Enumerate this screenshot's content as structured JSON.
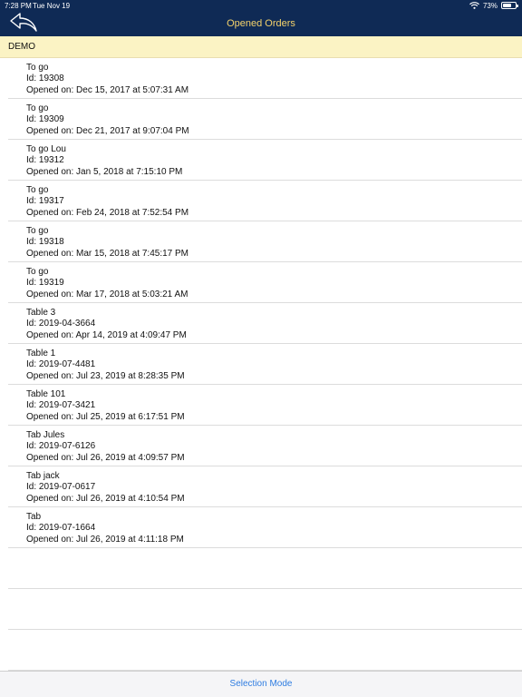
{
  "status_bar": {
    "time": "7:28 PM",
    "date": "Tue Nov 19",
    "battery_text": "73%",
    "battery_level": 0.73
  },
  "header": {
    "title": "Opened Orders",
    "back_icon": "curved-back-arrow-icon"
  },
  "section": {
    "label": "DEMO"
  },
  "orders": [
    {
      "name": "To go",
      "id": "Id: 19308",
      "opened": "Opened on: Dec 15, 2017 at 5:07:31 AM"
    },
    {
      "name": "To go",
      "id": "Id: 19309",
      "opened": "Opened on: Dec 21, 2017 at 9:07:04 PM"
    },
    {
      "name": "To go Lou",
      "id": "Id: 19312",
      "opened": "Opened on: Jan 5, 2018 at 7:15:10 PM"
    },
    {
      "name": "To go",
      "id": "Id: 19317",
      "opened": "Opened on: Feb 24, 2018 at 7:52:54 PM"
    },
    {
      "name": "To go",
      "id": "Id: 19318",
      "opened": "Opened on: Mar 15, 2018 at 7:45:17 PM"
    },
    {
      "name": "To go",
      "id": "Id: 19319",
      "opened": "Opened on: Mar 17, 2018 at 5:03:21 AM"
    },
    {
      "name": "Table 3",
      "id": "Id: 2019-04-3664",
      "opened": "Opened on: Apr 14, 2019 at 4:09:47 PM"
    },
    {
      "name": "Table 1",
      "id": "Id: 2019-07-4481",
      "opened": "Opened on: Jul 23, 2019 at 8:28:35 PM"
    },
    {
      "name": "Table 101",
      "id": "Id: 2019-07-3421",
      "opened": "Opened on: Jul 25, 2019 at 6:17:51 PM"
    },
    {
      "name": "Tab Jules",
      "id": "Id: 2019-07-6126",
      "opened": "Opened on: Jul 26, 2019 at 4:09:57 PM"
    },
    {
      "name": "Tab jack",
      "id": "Id: 2019-07-0617",
      "opened": "Opened on: Jul 26, 2019 at 4:10:54 PM"
    },
    {
      "name": "Tab",
      "id": "Id: 2019-07-1664",
      "opened": "Opened on: Jul 26, 2019 at 4:11:18 PM"
    }
  ],
  "footer": {
    "button_label": "Selection Mode"
  },
  "colors": {
    "header_bg": "#0f2a55",
    "title": "#f4d26b",
    "section_bg": "#fbf3c4",
    "link": "#2f7de1"
  }
}
